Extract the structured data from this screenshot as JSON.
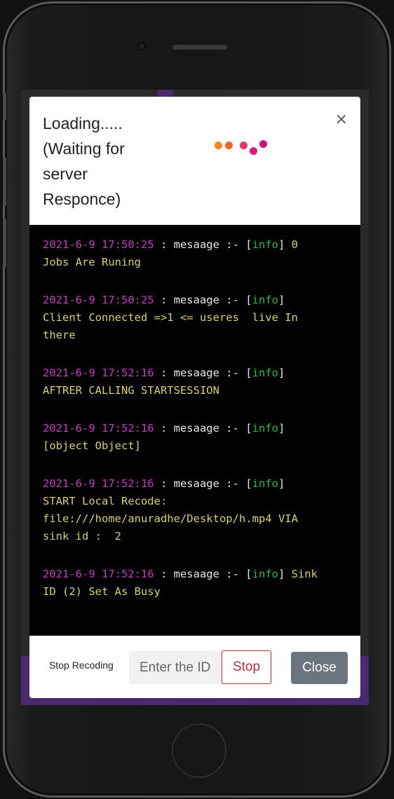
{
  "modal": {
    "title_lines": [
      "Loading.....",
      "(Waiting for",
      "server",
      "Responce)"
    ],
    "close_glyph": "×"
  },
  "loader": {
    "dot_colors": [
      "#f28a24",
      "#f0652c",
      "#e8366a",
      "#e0157d",
      "#d6117c"
    ]
  },
  "console": {
    "entries": [
      {
        "ts": "2021-6-9 17:50:25",
        "label": " : mesaage :- [",
        "tag": "info",
        "close": "]",
        "text": " 0\nJobs Are Runing"
      },
      {
        "ts": "2021-6-9 17:50:25",
        "label": " : mesaage :- [",
        "tag": "info",
        "close": "]",
        "text": "\nClient Connected =>1 <= useres  live In\nthere"
      },
      {
        "ts": "2021-6-9 17:52:16",
        "label": " : mesaage :- [",
        "tag": "info",
        "close": "]",
        "text": "\nAFTRER CALLING STARTSESSION"
      },
      {
        "ts": "2021-6-9 17:52:16",
        "label": " : mesaage :- [",
        "tag": "info",
        "close": "]",
        "text": "\n[object Object]"
      },
      {
        "ts": "2021-6-9 17:52:16",
        "label": " : mesaage :- [",
        "tag": "info",
        "close": "]",
        "text": "\nSTART Local Recode:\nfile:///home/anuradhe/Desktop/h.mp4 VIA\nsink id :  2"
      },
      {
        "ts": "2021-6-9 17:52:16",
        "label": " : mesaage :- [",
        "tag": "info",
        "close": "]",
        "text": " Sink\nID (2) Set As Busy"
      }
    ]
  },
  "footer": {
    "stop_label": "Stop Recoding",
    "id_placeholder": "Enter the ID",
    "stop_button": "Stop",
    "close_button": "Close"
  },
  "colors": {
    "timestamp": "#c23bc2",
    "info_tag": "#2fb84a",
    "message_text": "#d8d06a",
    "stop_accent": "#b7313a",
    "close_bg": "#6c757d",
    "backdrop_purple": "#4a2a6e"
  }
}
